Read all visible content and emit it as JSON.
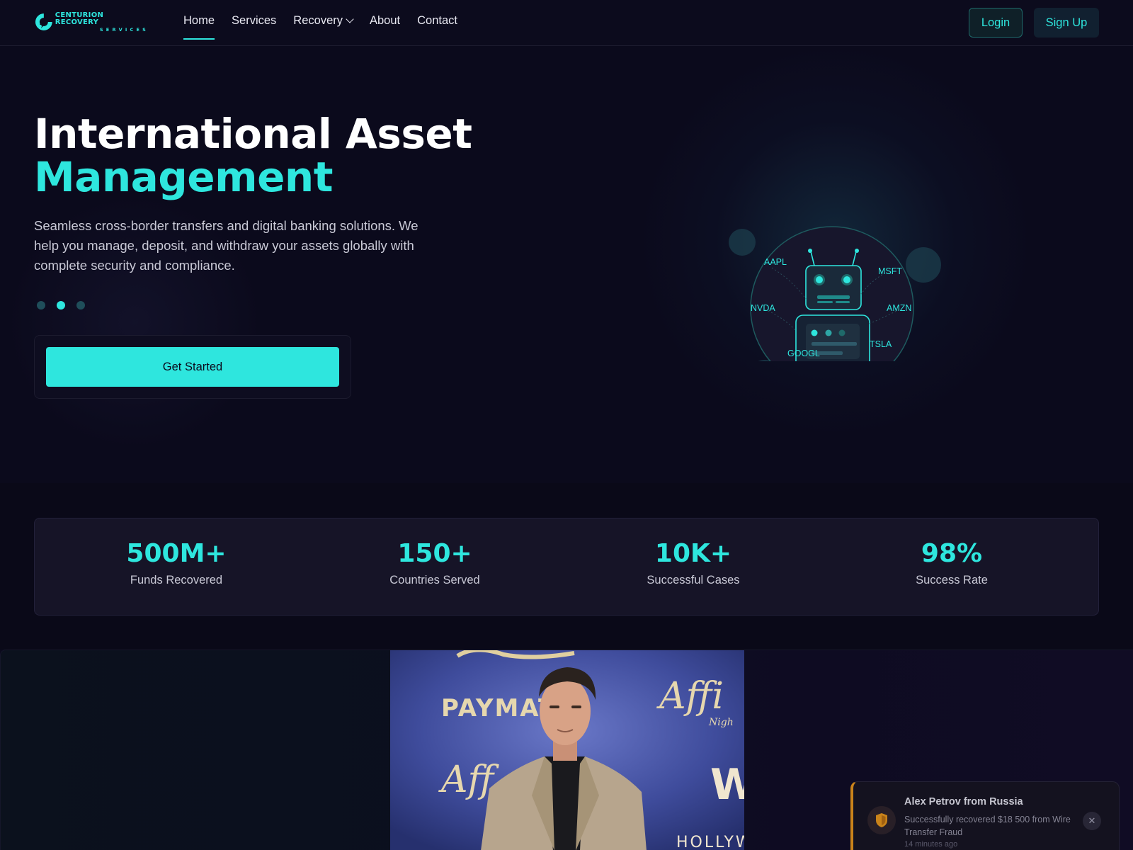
{
  "brand": {
    "name": "CENTURION RECOVERY",
    "sub": "SERVICES",
    "accent": "#2ee6de"
  },
  "nav": {
    "links": [
      {
        "label": "Home",
        "active": true
      },
      {
        "label": "Services"
      },
      {
        "label": "Recovery",
        "dropdown": true
      },
      {
        "label": "About"
      },
      {
        "label": "Contact"
      }
    ],
    "login": "Login",
    "signup": "Sign Up"
  },
  "hero": {
    "title_line1": "International Asset",
    "title_line2": "Management",
    "description": "Seamless cross-border transfers and digital banking solutions. We help you manage, deposit, and withdraw your assets globally with complete security and compliance.",
    "slides": {
      "count": 3,
      "active": 2
    },
    "cta": "Get Started",
    "tickers": [
      "AAPL",
      "MSFT",
      "NVDA",
      "AMZN",
      "TSLA",
      "GOOGL"
    ]
  },
  "stats": [
    {
      "value": "500M+",
      "label": "Funds Recovered"
    },
    {
      "value": "150+",
      "label": "Countries Served"
    },
    {
      "value": "10K+",
      "label": "Successful Cases"
    },
    {
      "value": "98%",
      "label": "Success Rate"
    }
  ],
  "photo": {
    "backdrop_text": [
      "PAYMAT",
      "HOLLYW"
    ]
  },
  "toast": {
    "title": "Alex Petrov from Russia",
    "message": "Successfully recovered $18 500 from Wire Transfer Fraud",
    "time": "14 minutes ago",
    "icon": "shield-icon",
    "accent": "#d48a1a"
  }
}
